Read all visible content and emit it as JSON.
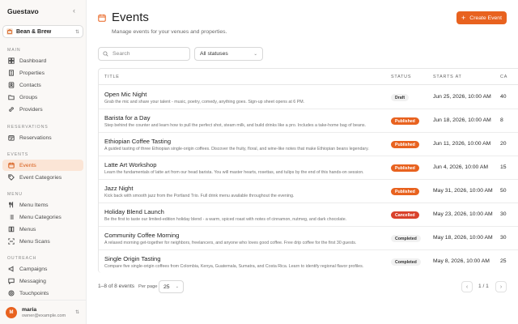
{
  "sidebar": {
    "brand": "Guestavo",
    "collapse_glyph": "‹",
    "venue": "Bean & Brew",
    "sections": {
      "main": "MAIN",
      "reservations": "RESERVATIONS",
      "events": "EVENTS",
      "menu": "MENU",
      "outreach": "OUTREACH"
    },
    "items": {
      "dashboard": "Dashboard",
      "properties": "Properties",
      "contacts": "Contacts",
      "groups": "Groups",
      "providers": "Providers",
      "reservations": "Reservations",
      "events": "Events",
      "event_categories": "Event Categories",
      "menu_items": "Menu Items",
      "menu_categories": "Menu Categories",
      "menus": "Menus",
      "menu_scans": "Menu Scans",
      "campaigns": "Campaigns",
      "messaging": "Messaging",
      "touchpoints": "Touchpoints"
    },
    "active_item": "Events",
    "user": {
      "initial": "M",
      "name": "maria",
      "email": "owner@example.com"
    }
  },
  "header": {
    "title": "Events",
    "subtitle": "Manage events for your venues and properties.",
    "create_label": "Create Event",
    "create_plus": "+"
  },
  "filters": {
    "search_placeholder": "Search",
    "status_selected": "All statuses"
  },
  "table": {
    "columns": {
      "title": "TITLE",
      "status": "STATUS",
      "starts_at": "STARTS AT",
      "capacity": "CA"
    },
    "rows": [
      {
        "title": "Open Mic Night",
        "desc": "Grab the mic and share your talent - music, poetry, comedy, anything goes. Sign-up sheet opens at 6 PM.",
        "status": "Draft",
        "starts": "Jun 25, 2026, 10:00 AM",
        "cap": "40"
      },
      {
        "title": "Barista for a Day",
        "desc": "Step behind the counter and learn how to pull the perfect shot, steam milk, and build drinks like a pro. Includes a take-home bag of beans.",
        "status": "Published",
        "starts": "Jun 18, 2026, 10:00 AM",
        "cap": "8"
      },
      {
        "title": "Ethiopian Coffee Tasting",
        "desc": "A guided tasting of three Ethiopian single-origin coffees. Discover the fruity, floral, and wine-like notes that make Ethiopian beans legendary.",
        "status": "Published",
        "starts": "Jun 11, 2026, 10:00 AM",
        "cap": "20"
      },
      {
        "title": "Latte Art Workshop",
        "desc": "Learn the fundamentals of latte art from our head barista. You will master hearts, rosettas, and tulips by the end of this hands-on session.",
        "status": "Published",
        "starts": "Jun 4, 2026, 10:00 AM",
        "cap": "15"
      },
      {
        "title": "Jazz Night",
        "desc": "Kick back with smooth jazz from the Portland Trio. Full drink menu available throughout the evening.",
        "status": "Published",
        "starts": "May 31, 2026, 10:00 AM",
        "cap": "50"
      },
      {
        "title": "Holiday Blend Launch",
        "desc": "Be the first to taste our limited-edition holiday blend - a warm, spiced roast with notes of cinnamon, nutmeg, and dark chocolate.",
        "status": "Cancelled",
        "starts": "May 23, 2026, 10:00 AM",
        "cap": "30"
      },
      {
        "title": "Community Coffee Morning",
        "desc": "A relaxed morning get-together for neighbors, freelancers, and anyone who loves good coffee. Free drip coffee for the first 30 guests.",
        "status": "Completed",
        "starts": "May 18, 2026, 10:00 AM",
        "cap": "30"
      },
      {
        "title": "Single Origin Tasting",
        "desc": "Compare five single-origin coffees from Colombia, Kenya, Guatemala, Sumatra, and Costa Rica. Learn to identify regional flavor profiles.",
        "status": "Completed",
        "starts": "May 8, 2026, 10:00 AM",
        "cap": "25"
      }
    ]
  },
  "footer": {
    "count": "1–8 of 8 events",
    "per_page_label": "Per page",
    "per_page_value": "25",
    "page_label": "1 / 1",
    "prev": "‹",
    "next": "›"
  },
  "colors": {
    "accent": "#e8621f",
    "active_bg": "#fbe5d6",
    "cancelled": "#d9412b"
  }
}
